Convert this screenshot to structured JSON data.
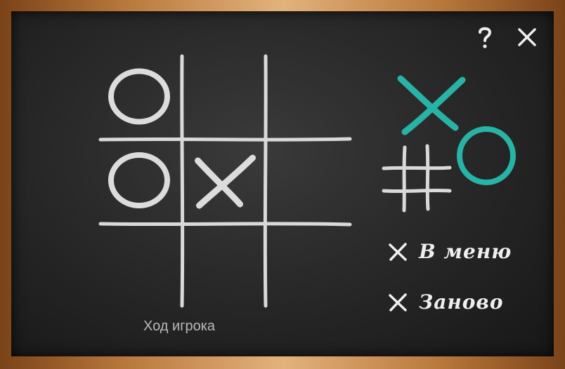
{
  "header": {
    "help_icon": "question-mark-icon",
    "close_icon": "close-icon"
  },
  "game": {
    "cells": [
      "O",
      "",
      "",
      "O",
      "X",
      "",
      "",
      "",
      ""
    ],
    "status_text": "Ход игрока"
  },
  "logo": {
    "accent_color": "#27b3a6"
  },
  "menu": {
    "to_menu_label": "В меню",
    "restart_label": "Заново"
  }
}
